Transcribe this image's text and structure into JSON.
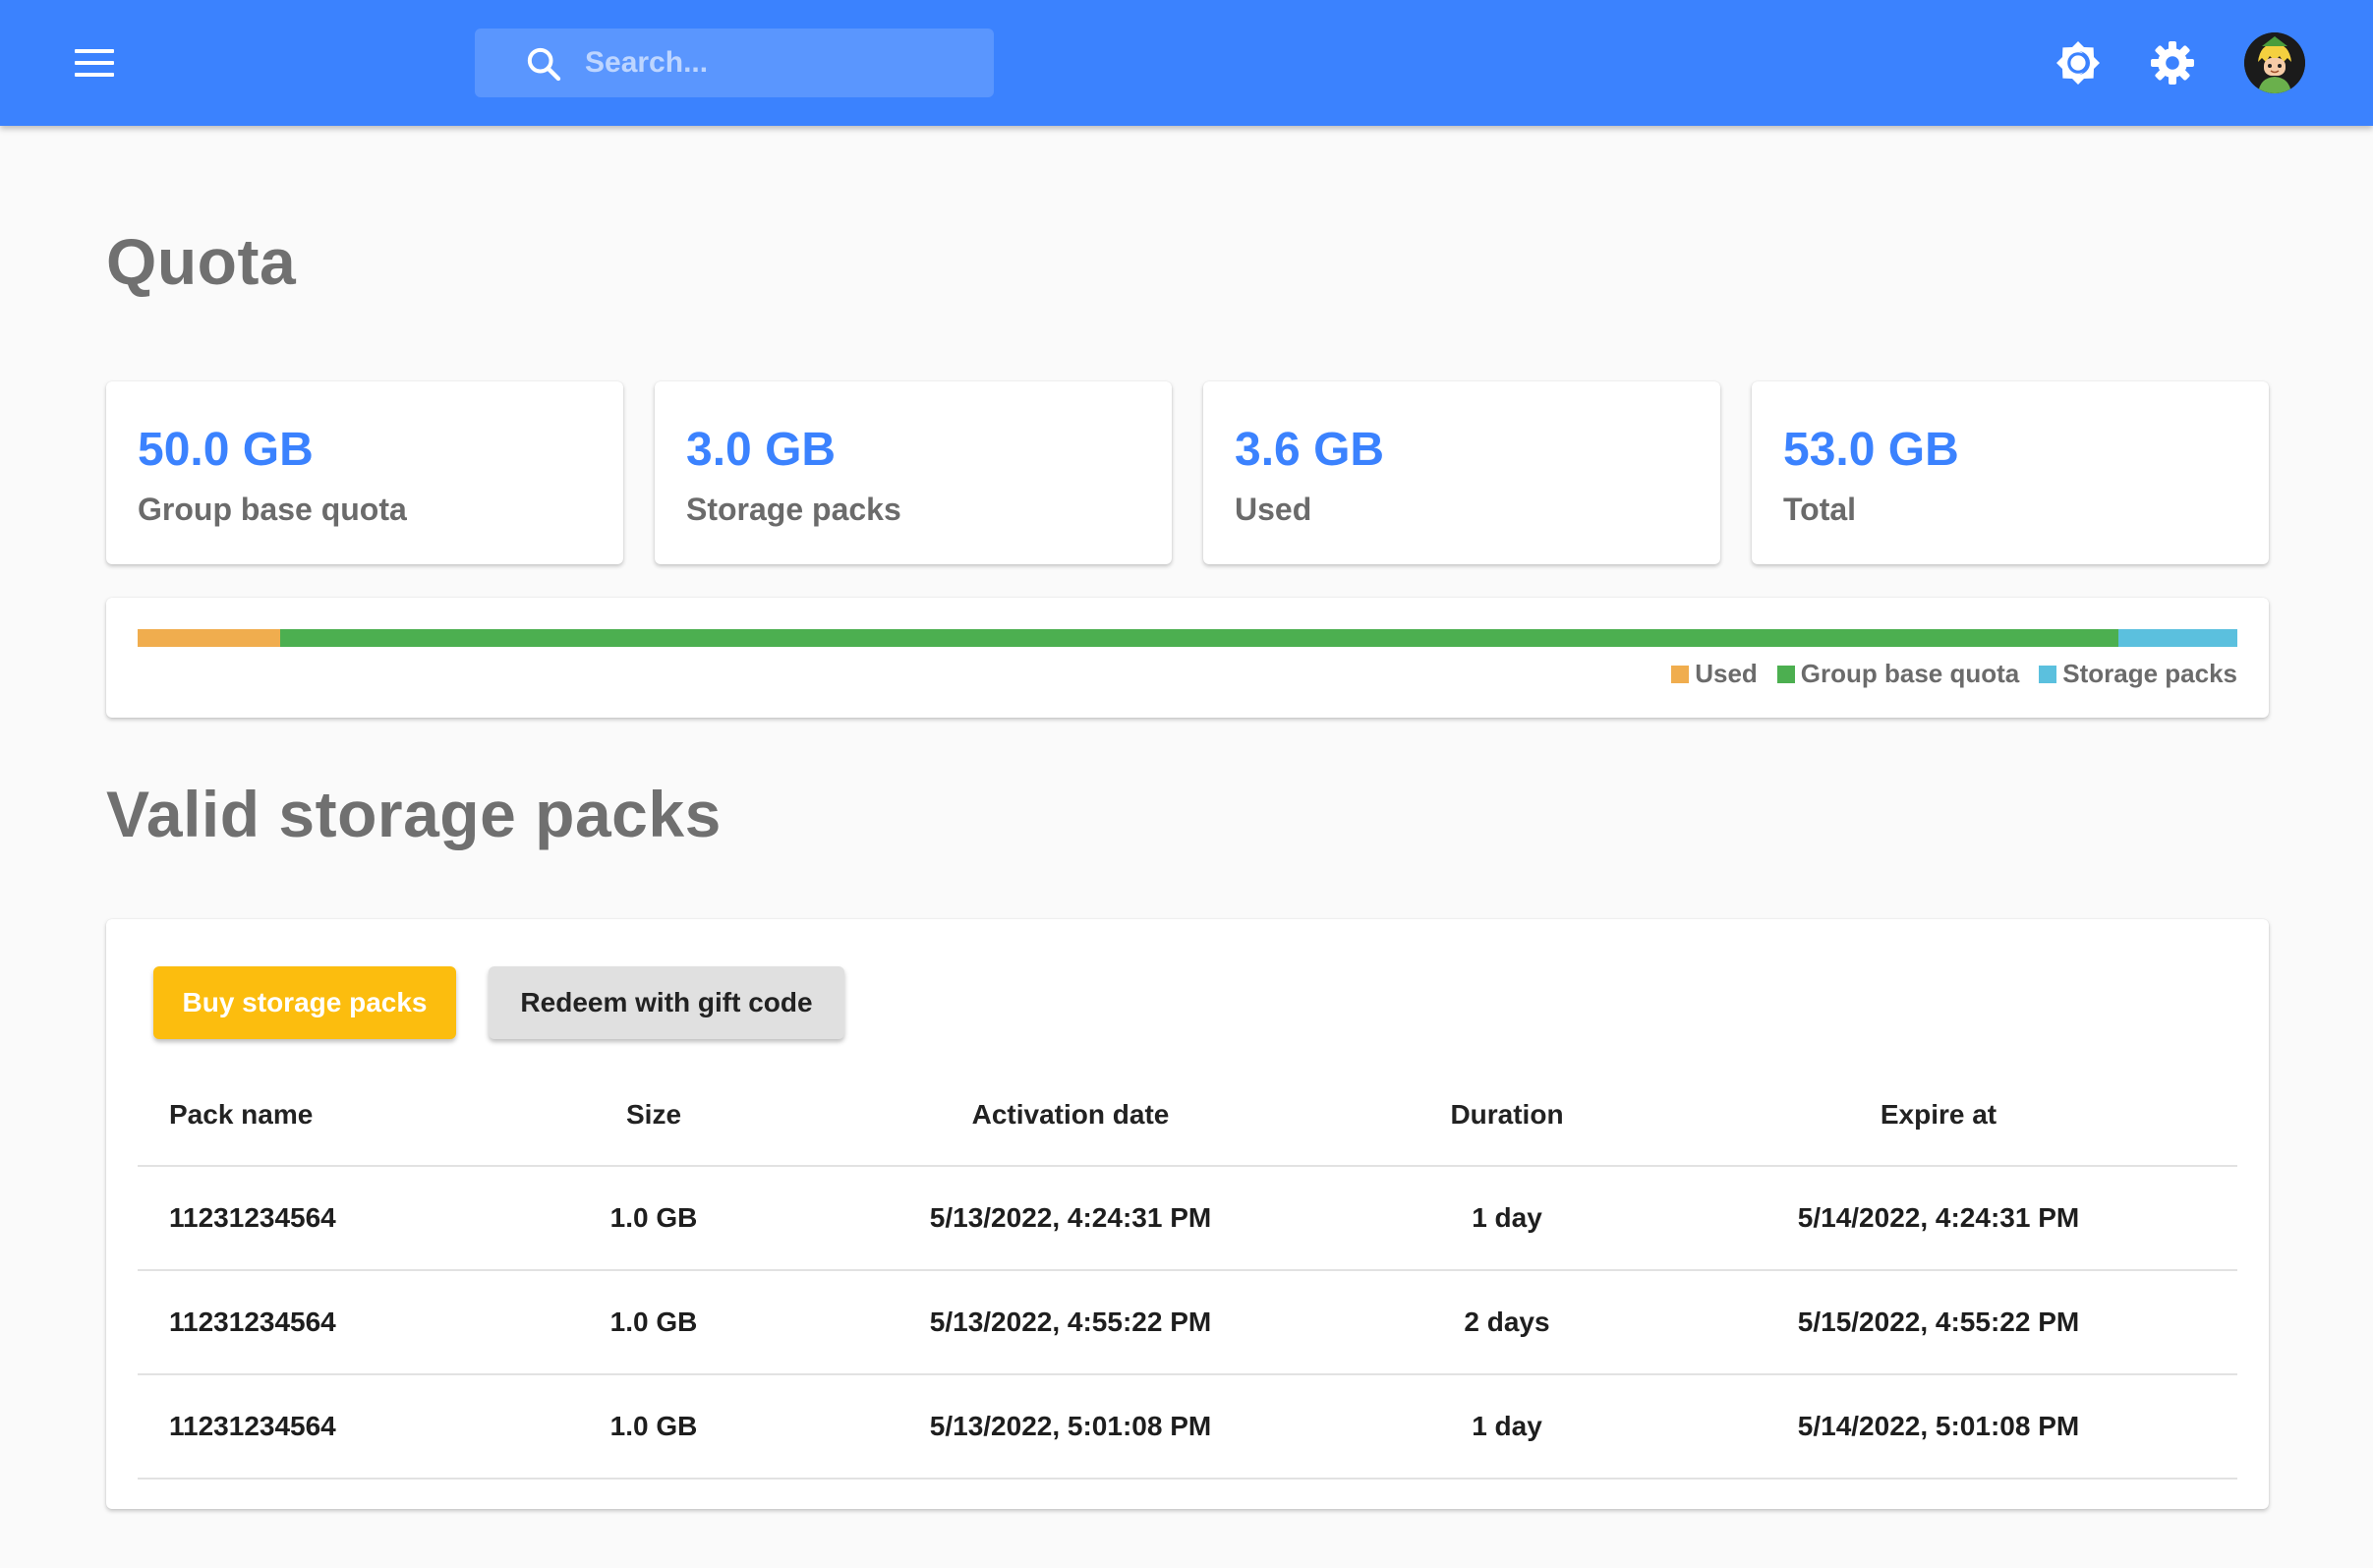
{
  "header": {
    "search_placeholder": "Search...",
    "icons": [
      "menu-icon",
      "search-icon",
      "brightness-icon",
      "gear-icon",
      "avatar"
    ],
    "colors": {
      "appbar": "#3b82fe"
    }
  },
  "quota": {
    "title": "Quota",
    "stats": [
      {
        "value": "50.0 GB",
        "label": "Group base quota"
      },
      {
        "value": "3.0 GB",
        "label": "Storage packs"
      },
      {
        "value": "3.6 GB",
        "label": "Used"
      },
      {
        "value": "53.0 GB",
        "label": "Total"
      }
    ],
    "usage_bar": {
      "segments": [
        {
          "name": "used",
          "gb": 3.6,
          "color": "#f0ad4e"
        },
        {
          "name": "group-base-quota",
          "gb": 46.4,
          "color": "#4caf50"
        },
        {
          "name": "storage-packs",
          "gb": 3.0,
          "color": "#5bc0de"
        }
      ],
      "total_gb": 53.0
    },
    "legend": [
      {
        "label": "Used",
        "color": "#f0ad4e"
      },
      {
        "label": "Group base quota",
        "color": "#4caf50"
      },
      {
        "label": "Storage packs",
        "color": "#5bc0de"
      }
    ]
  },
  "packs": {
    "title": "Valid storage packs",
    "buy_label": "Buy storage packs",
    "redeem_label": "Redeem with gift code",
    "columns": [
      "Pack name",
      "Size",
      "Activation date",
      "Duration",
      "Expire at"
    ],
    "rows": [
      [
        "11231234564",
        "1.0 GB",
        "5/13/2022, 4:24:31 PM",
        "1 day",
        "5/14/2022, 4:24:31 PM"
      ],
      [
        "11231234564",
        "1.0 GB",
        "5/13/2022, 4:55:22 PM",
        "2 days",
        "5/15/2022, 4:55:22 PM"
      ],
      [
        "11231234564",
        "1.0 GB",
        "5/13/2022, 5:01:08 PM",
        "1 day",
        "5/14/2022, 5:01:08 PM"
      ]
    ]
  }
}
